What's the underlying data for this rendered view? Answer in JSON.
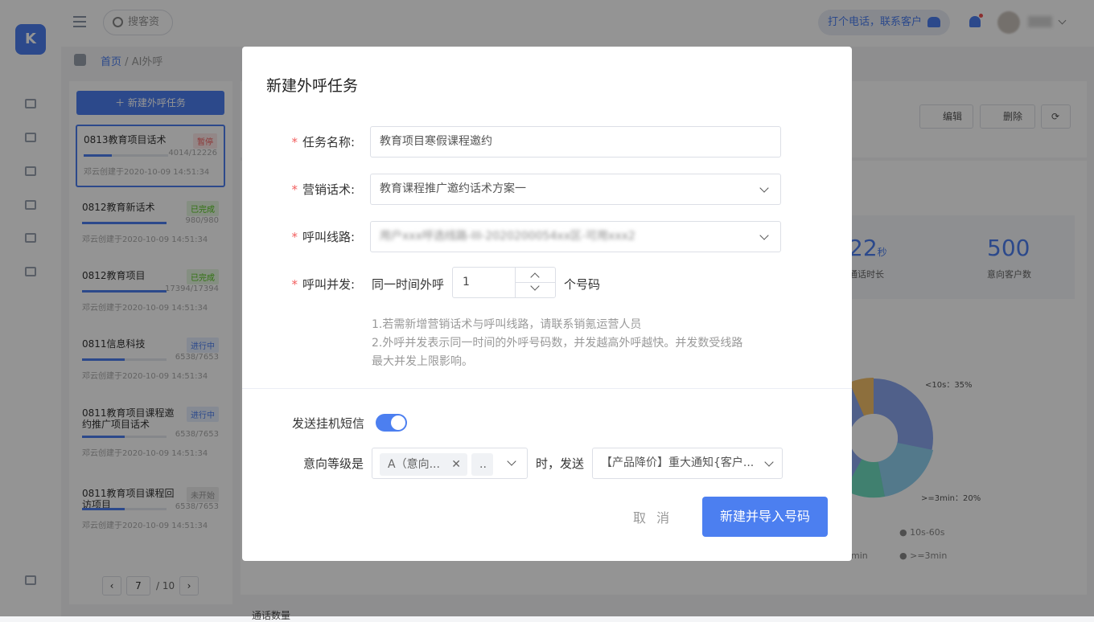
{
  "topbar": {
    "search_placeholder": "搜客资",
    "call_button": "打个电话，联系客户",
    "user_name": "张张"
  },
  "breadcrumb": {
    "home": "首页",
    "separator": "/",
    "current": "AI外呼"
  },
  "task_list": {
    "new_button": "新建外呼任务",
    "items": [
      {
        "name": "0813教育项目话术",
        "status": "暂停",
        "progress": "4014/12226",
        "progress_fraction": 0.33,
        "meta": "邓云创建于2020-10-09 14:51:34"
      },
      {
        "name": "0812教育新话术",
        "status": "已完成",
        "progress": "980/980",
        "progress_fraction": 1.0,
        "meta": "邓云创建于2020-10-09 14:51:34"
      },
      {
        "name": "0812教育项目",
        "status": "已完成",
        "progress": "17394/17394",
        "progress_fraction": 1.0,
        "meta": "邓云创建于2020-10-09 14:51:34"
      },
      {
        "name": "0811信息科技",
        "status": "进行中",
        "progress": "6538/7653",
        "progress_fraction": 0.5,
        "meta": "邓云创建于2020-10-09 14:51:34"
      },
      {
        "name": "0811教育项目课程邀约推广项目话术",
        "status": "进行中",
        "progress": "6538/7653",
        "progress_fraction": 0.5,
        "meta": "邓云创建于2020-10-09 14:51:34"
      },
      {
        "name": "0811教育项目课程回访项目",
        "status": "未开始",
        "progress": "6538/7653",
        "progress_fraction": 0.5,
        "meta": "邓云创建于2020-10-09 14:51:34"
      }
    ],
    "pager": {
      "page": "7",
      "total": "/ 10"
    }
  },
  "background": {
    "edit": "编辑",
    "delete": "删除",
    "stat_duration": "22",
    "stat_duration_unit": "秒",
    "stat_duration_label": "通话时长",
    "stat_intent": "500",
    "stat_intent_label": "意向客户数",
    "pie_label_1": "<10s：35%",
    "pie_label_2": ">=3min：20%",
    "legend_1": "10s-60s",
    "legend_2": ">=3min",
    "legend_3": "min",
    "bottom_title": "通话数量"
  },
  "modal": {
    "title": "新建外呼任务",
    "task_name_label": "任务名称:",
    "task_name_value": "教育项目寒假课程邀约",
    "script_label": "营销话术:",
    "script_value": "教育课程推广邀约话术方案一",
    "line_label": "呼叫线路:",
    "line_value": "用户xxx呼选线路-III-2020200054xx区-可用xxx2",
    "concurrency_label": "呼叫并发:",
    "concurrency_prefix": "同一时间外呼",
    "concurrency_value": "1",
    "concurrency_suffix": "个号码",
    "hint_1": "1.若需新增营销话术与呼叫线路，请联系销氪运营人员",
    "hint_2": "2.外呼并发表示同一时间的外呼号码数，并发越高外呼越快。并发数受线路",
    "hint_3": "最大并发上限影响。",
    "sms_label": "发送挂机短信",
    "sms_enabled": true,
    "intent_label": "意向等级是",
    "intent_tag": "A（意向...",
    "intent_more": "..",
    "when_send": "时，发送",
    "sms_template": "【产品降价】重大通知{客户...",
    "cancel": "取 消",
    "confirm": "新建并导入号码"
  },
  "colors": {
    "accent": "#4c7ff0",
    "danger": "#f25e5e",
    "success": "#52c41a"
  }
}
